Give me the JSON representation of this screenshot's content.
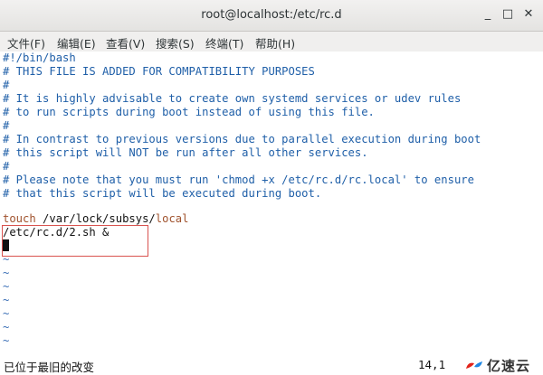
{
  "window": {
    "title": "root@localhost:/etc/rc.d",
    "buttons": {
      "minimize": "_",
      "maximize": "□",
      "close": "✕"
    }
  },
  "menu": {
    "items": [
      "文件(F)",
      "编辑(E)",
      "查看(V)",
      "搜索(S)",
      "终端(T)",
      "帮助(H)"
    ]
  },
  "editor": {
    "lines": [
      "#!/bin/bash",
      "# THIS FILE IS ADDED FOR COMPATIBILITY PURPOSES",
      "#",
      "# It is highly advisable to create own systemd services or udev rules",
      "# to run scripts during boot instead of using this file.",
      "#",
      "# In contrast to previous versions due to parallel execution during boot",
      "# this script will NOT be run after all other services.",
      "#",
      "# Please note that you must run 'chmod +x /etc/rc.d/rc.local' to ensure",
      "# that this script will be executed during boot.",
      ""
    ],
    "touch_cmd": "touch",
    "touch_sep1": " /var/lock/subsys/",
    "touch_arg": "local",
    "added_line": "/etc/rc.d/2.sh &",
    "tilde": "~"
  },
  "status": {
    "message": "已位于最旧的改变",
    "position": "14,1"
  },
  "watermark": {
    "text": "亿速云",
    "icon": "cloud-logo-icon",
    "colors": {
      "red": "#e2231a",
      "blue": "#1e88e5"
    }
  },
  "colors": {
    "comment": "#1f5fa8",
    "keyword": "#a0522d",
    "tilde": "#3b6fb6",
    "highlight_box": "#d9534f"
  }
}
